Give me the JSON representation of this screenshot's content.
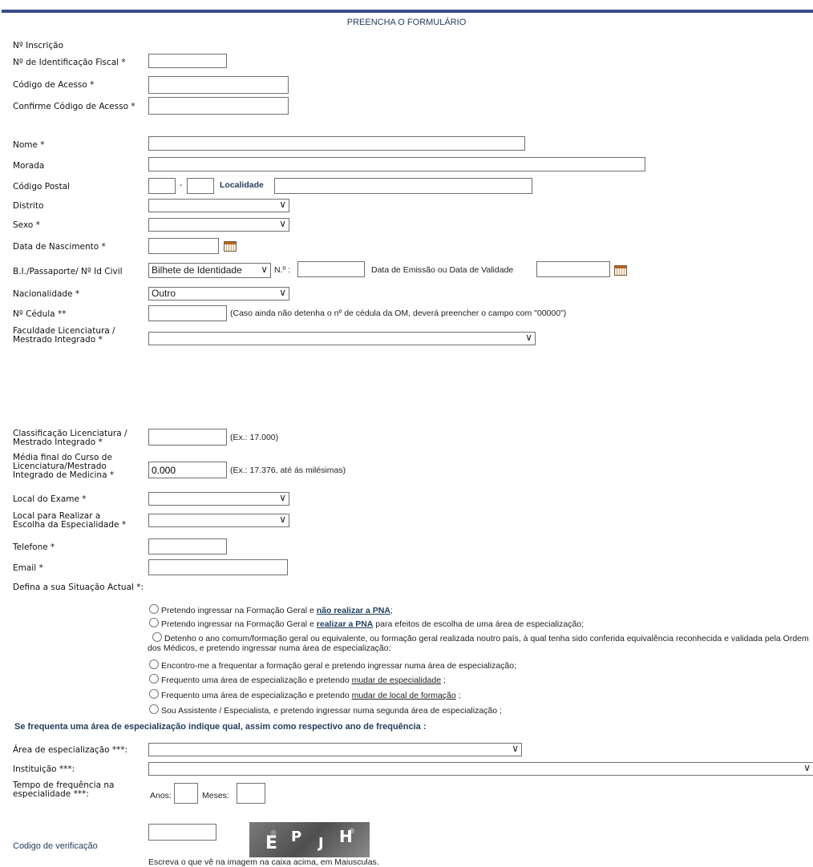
{
  "form": {
    "title": "PREENCHA O FORMULÁRIO",
    "labels": {
      "inscricao": "Nº Inscrição",
      "nif": "Nº de Identificação Fiscal *",
      "codigo_acesso": "Código de Acesso *",
      "confirme_codigo": "Confirme Código de Acesso *",
      "nome": "Nome *",
      "morada": "Morada",
      "codigo_postal": "Código Postal",
      "localidade": "Localidade",
      "distrito": "Distrito",
      "sexo": "Sexo *",
      "data_nascimento": "Data de Nascimento *",
      "bi": "B.I./Passaporte/ Nº Id Civil",
      "numero": "N.º :",
      "data_emissao": "Data de Emissão ou Data de Validade",
      "nacionalidade": "Nacionalidade *",
      "cedula": "Nº Cédula **",
      "cedula_hint": "(Caso ainda não detenha o nº de cédula da OM, deverá preencher o campo com \"00000\")",
      "faculdade_1": "Faculdade Licenciatura /",
      "faculdade_2": "Mestrado Integrado *",
      "classificacao_1": "Classificação Licenciatura /",
      "classificacao_2": "Mestrado Integrado *",
      "classificacao_hint": "(Ex.: 17.000)",
      "media_1": "Média final do Curso de",
      "media_2": "Licenciatura/Mestrado",
      "media_3": "Integrado de Medicina *",
      "media_hint": "(Ex.: 17.376, até ás milésimas)",
      "local_exame": "Local do Exame *",
      "local_escolha_1": "Local para Realizar a",
      "local_escolha_2": "Escolha da Especialidade *",
      "telefone": "Telefone *",
      "email": "Email *",
      "situacao": "Defina a sua Situação Actual *:",
      "especializacao_intro": "Se frequenta uma área de especialização indique qual, assim como respectivo ano de frequência :",
      "area": "Área de especialização ***:",
      "instituicao": "Instituição ***:",
      "tempo_1": "Tempo de frequência na",
      "tempo_2": "especialidade ***:",
      "anos": "Anos:",
      "meses": "Meses:",
      "codigo_verificacao": "Codigo de verificação",
      "captcha_hint": "Escreva o que vê na imagem na caixa acima, em Maiusculas."
    },
    "values": {
      "bi_type": "Bilhete de Identidade",
      "nacionalidade": "Outro",
      "media": "0.000"
    },
    "situacao_options": [
      {
        "pre": "Pretendo ingressar na Formação Geral e ",
        "link": "não realizar a PNA",
        "post": ";"
      },
      {
        "pre": "Pretendo ingressar na Formação Geral e ",
        "link": "realizar a PNA",
        "post": " para efeitos de escolha de uma área de especialização;"
      },
      {
        "pre": "Detenho o ano comum/formação geral ou equivalente, ou formação geral realizada noutro país, à qual tenha sido conferida equivalência reconhecida e validada pela Ordem dos Médicos, e pretendo ingressar numa área de especialização;",
        "link": "",
        "post": ""
      },
      {
        "pre": "Encontro-me a frequentar a formação geral e pretendo ingressar numa área de especialização;",
        "link": "",
        "post": ""
      },
      {
        "pre": "Frequento uma área de especialização e pretendo ",
        "link": "mudar de especialidade",
        "post": " ;"
      },
      {
        "pre": "Frequento uma área de especialização e pretendo ",
        "link": "mudar de local de formação",
        "post": " ;"
      },
      {
        "pre": "Sou Assistente / Especialista, e pretendo ingressar numa segunda área de especialização ;",
        "link": "",
        "post": ""
      }
    ],
    "captcha_text": "EPJH",
    "colors": {
      "topbar": "#3a4a8c",
      "accent_text": "#1f3d5c"
    }
  }
}
